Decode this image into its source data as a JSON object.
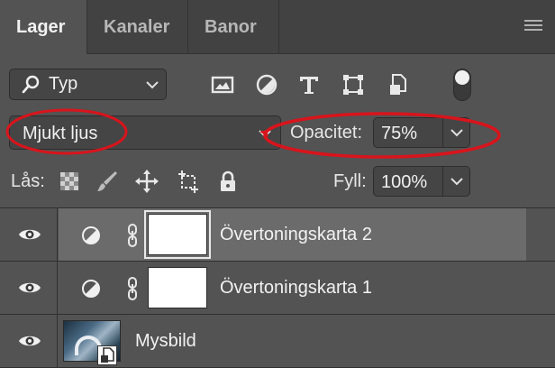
{
  "tabs": [
    {
      "label": "Lager",
      "active": true
    },
    {
      "label": "Kanaler",
      "active": false
    },
    {
      "label": "Banor",
      "active": false
    }
  ],
  "filter": {
    "kind_label": "Typ",
    "icons": [
      "image-filter-icon",
      "adjustment-filter-icon",
      "type-filter-icon",
      "shape-filter-icon",
      "smart-object-filter-icon"
    ]
  },
  "blend": {
    "mode": "Mjukt ljus",
    "opacity_label": "Opacitet:",
    "opacity_value": "75%"
  },
  "lock": {
    "label": "Lås:",
    "fill_label": "Fyll:",
    "fill_value": "100%"
  },
  "layers": [
    {
      "name": "Övertoningskarta 2",
      "type": "gradient-map",
      "selected": true,
      "visible": true
    },
    {
      "name": "Övertoningskarta 1",
      "type": "gradient-map",
      "selected": false,
      "visible": true
    },
    {
      "name": "Mysbild",
      "type": "smart-object",
      "selected": false,
      "visible": true
    }
  ],
  "colors": {
    "panel": "#535353",
    "tabbar": "#424242",
    "selected_row": "#6b6b6b",
    "annotation": "#d8141c"
  }
}
